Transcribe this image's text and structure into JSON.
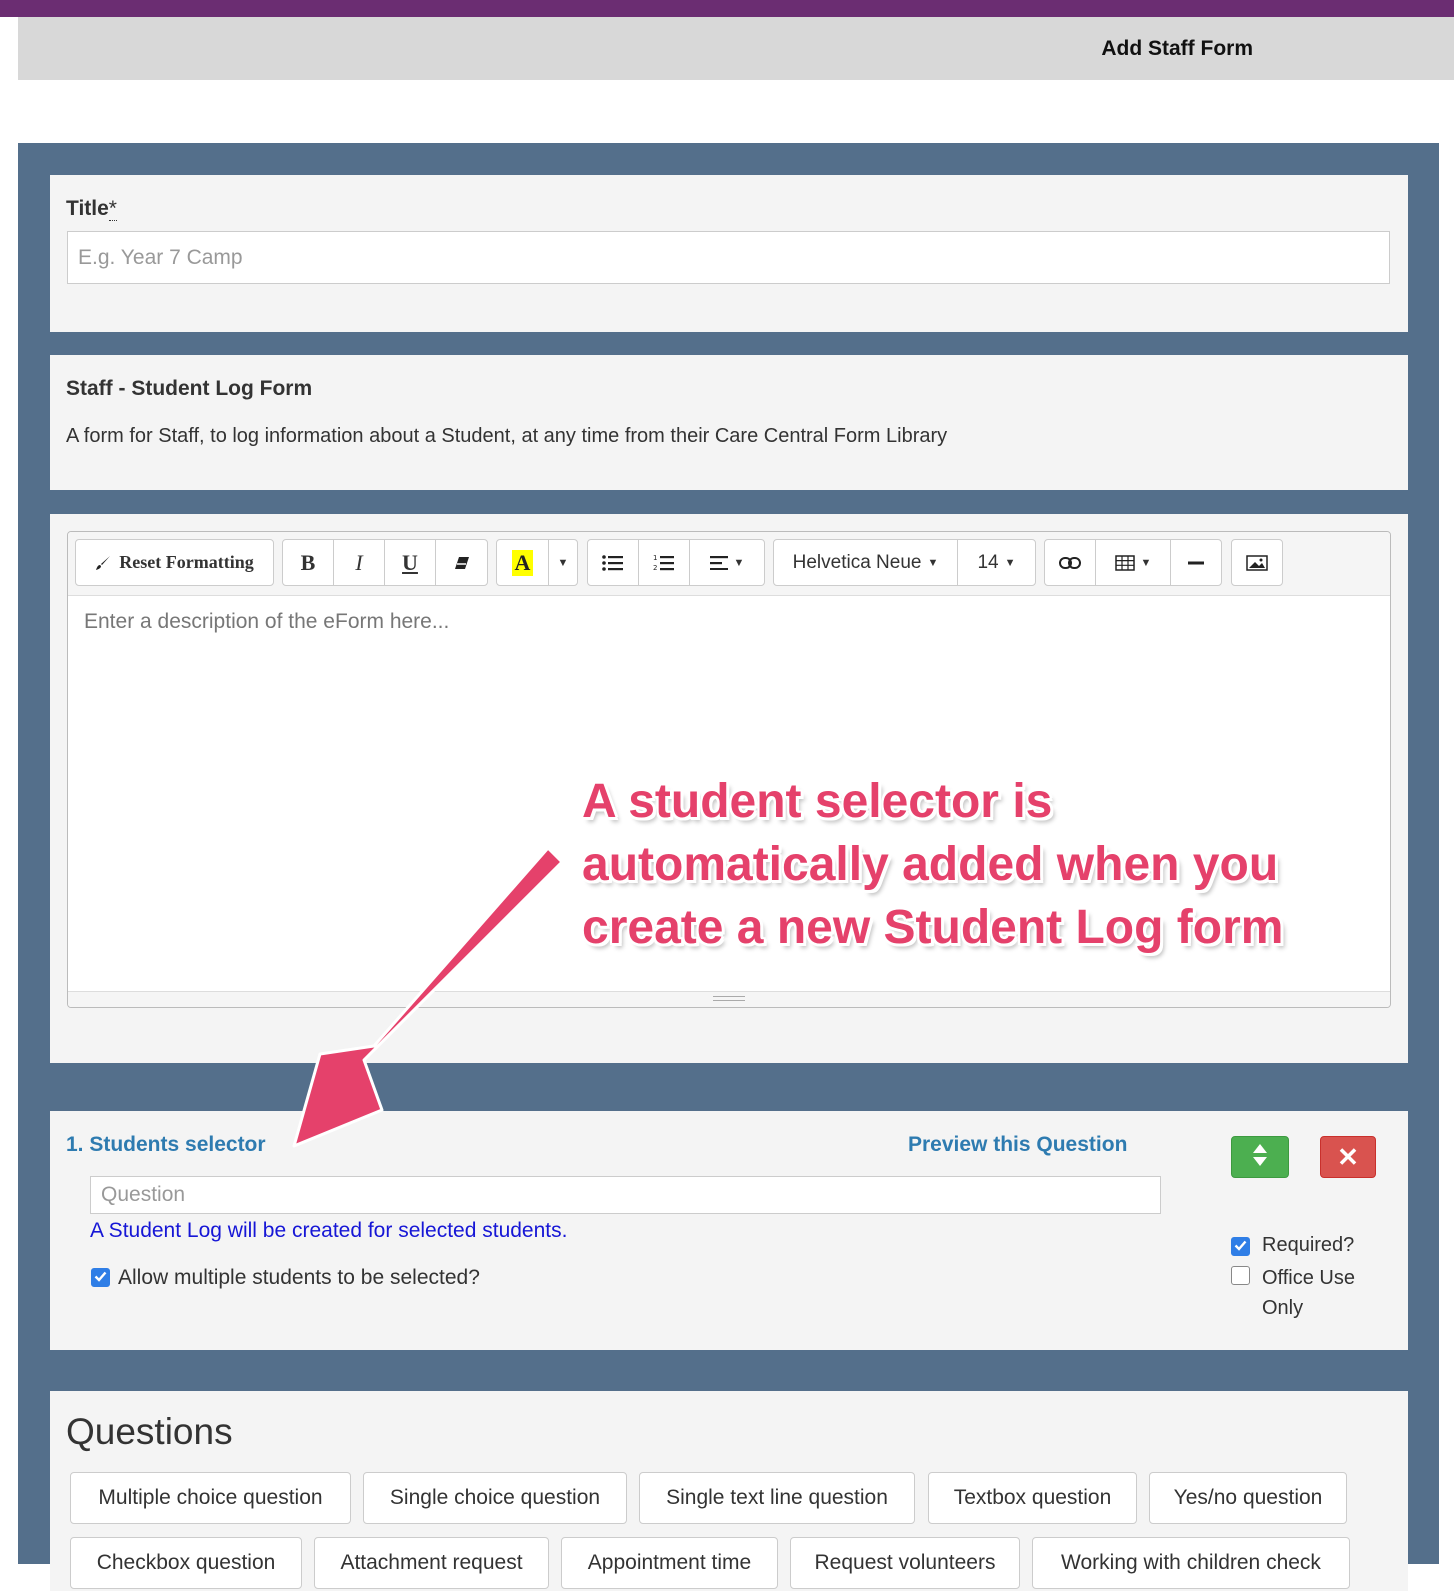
{
  "header": {
    "title": "Add Staff Form"
  },
  "title_section": {
    "label": "Title",
    "required_mark": "*",
    "placeholder": "E.g. Year 7 Camp"
  },
  "form_info": {
    "name": "Staff - Student Log Form",
    "description": "A form for Staff, to log information about a Student, at any time from their Care Central Form Library"
  },
  "editor": {
    "reset_label": "Reset Formatting",
    "bold": "B",
    "italic": "I",
    "underline": "U",
    "highlight": "A",
    "font_name": "Helvetica Neue",
    "font_size": "14",
    "placeholder": "Enter a description of the eForm here..."
  },
  "question": {
    "label": "1. Students selector",
    "preview_link": "Preview this Question",
    "delete_symbol": "✕",
    "placeholder": "Question",
    "note": "A Student Log will be created for selected students.",
    "allow_multiple_label": "Allow multiple students to be selected?",
    "allow_multiple_checked": true,
    "required_label": "Required?",
    "required_checked": true,
    "office_use_label": "Office Use Only",
    "office_use_checked": false
  },
  "questions_section": {
    "heading": "Questions",
    "types_row1": [
      "Multiple choice question",
      "Single choice question",
      "Single text line question",
      "Textbox question",
      "Yes/no question"
    ],
    "types_row2": [
      "Checkbox question",
      "Attachment request",
      "Appointment time",
      "Request volunteers",
      "Working with children check"
    ]
  },
  "annotation": {
    "lines": [
      "A student selector is",
      "automatically added when you",
      "create a new Student Log form"
    ],
    "color": "#e5416b"
  },
  "colors": {
    "topbar": "#6b2d72",
    "frame": "#546f8b",
    "link": "#2e7bb0",
    "success": "#4caf50",
    "danger": "#d9534f"
  }
}
